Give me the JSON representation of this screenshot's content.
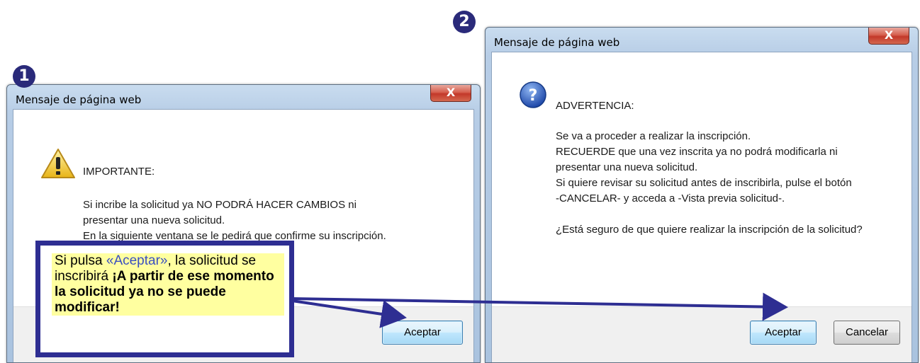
{
  "step_badges": [
    "1",
    "2"
  ],
  "dialog1": {
    "title": "Mensaje de página web",
    "close_label": "X",
    "icon": "warning-icon",
    "heading": "IMPORTANTE:",
    "lines": [
      "Si incribe la solicitud ya NO PODRÁ HACER CAMBIOS ni",
      "presentar una nueva solicitud.",
      "En la siguiente ventana se le pedirá que confirme su inscripción."
    ],
    "ok_label": "Aceptar"
  },
  "dialog2": {
    "title": "Mensaje de página web",
    "close_label": "X",
    "icon": "question-icon",
    "heading": "ADVERTENCIA:",
    "lines": [
      "Se va a proceder a realizar la inscripción.",
      "RECUERDE que una vez inscrita ya no podrá modificarla ni",
      "presentar una nueva solicitud.",
      "Si quiere revisar su solicitud antes de inscribirla, pulse el botón",
      "-CANCELAR- y acceda a -Vista previa solicitud-."
    ],
    "question": "¿Está seguro de que quiere realizar la inscripción de la solicitud?",
    "ok_label": "Aceptar",
    "cancel_label": "Cancelar"
  },
  "callout": {
    "part1": "Si pulsa ",
    "accent": "«Aceptar»",
    "part2": ", la solicitud se inscribirá ",
    "bold": "¡A partir de ese momento la solicitud ya no se puede modificar!"
  },
  "colors": {
    "callout_border": "#2e2e92",
    "callout_fill": "#ffffa0",
    "accent_text": "#3a4fc0"
  }
}
